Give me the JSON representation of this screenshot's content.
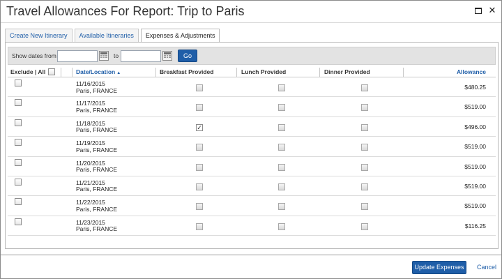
{
  "dialog": {
    "title": "Travel Allowances For Report: Trip to Paris",
    "maximize_icon": "maximize-icon",
    "close_icon": "close-icon"
  },
  "tabs": [
    {
      "label": "Create New Itinerary",
      "active": false
    },
    {
      "label": "Available Itineraries",
      "active": false
    },
    {
      "label": "Expenses & Adjustments",
      "active": true
    }
  ],
  "filter": {
    "from_label": "Show dates from",
    "to_label": "to",
    "from_value": "",
    "to_value": "",
    "go_label": "Go",
    "calendar_icon": "calendar-icon"
  },
  "columns": {
    "exclude": "Exclude | All",
    "date_location": "Date/Location",
    "sort_icon": "sort-ascending-icon",
    "breakfast": "Breakfast Provided",
    "lunch": "Lunch Provided",
    "dinner": "Dinner Provided",
    "allowance": "Allowance"
  },
  "rows": [
    {
      "date": "11/16/2015",
      "location": "Paris, FRANCE",
      "exclude": false,
      "breakfast": false,
      "lunch": false,
      "dinner": false,
      "allowance": "$480.25"
    },
    {
      "date": "11/17/2015",
      "location": "Paris, FRANCE",
      "exclude": false,
      "breakfast": false,
      "lunch": false,
      "dinner": false,
      "allowance": "$519.00"
    },
    {
      "date": "11/18/2015",
      "location": "Paris, FRANCE",
      "exclude": false,
      "breakfast": true,
      "lunch": false,
      "dinner": false,
      "allowance": "$496.00"
    },
    {
      "date": "11/19/2015",
      "location": "Paris, FRANCE",
      "exclude": false,
      "breakfast": false,
      "lunch": false,
      "dinner": false,
      "allowance": "$519.00"
    },
    {
      "date": "11/20/2015",
      "location": "Paris, FRANCE",
      "exclude": false,
      "breakfast": false,
      "lunch": false,
      "dinner": false,
      "allowance": "$519.00"
    },
    {
      "date": "11/21/2015",
      "location": "Paris, FRANCE",
      "exclude": false,
      "breakfast": false,
      "lunch": false,
      "dinner": false,
      "allowance": "$519.00"
    },
    {
      "date": "11/22/2015",
      "location": "Paris, FRANCE",
      "exclude": false,
      "breakfast": false,
      "lunch": false,
      "dinner": false,
      "allowance": "$519.00"
    },
    {
      "date": "11/23/2015",
      "location": "Paris, FRANCE",
      "exclude": false,
      "breakfast": false,
      "lunch": false,
      "dinner": false,
      "allowance": "$116.25"
    }
  ],
  "footer": {
    "update_label": "Update Expenses",
    "cancel_label": "Cancel"
  },
  "colors": {
    "accent": "#1f5ea8",
    "filter_bar": "#e3e3e3"
  }
}
